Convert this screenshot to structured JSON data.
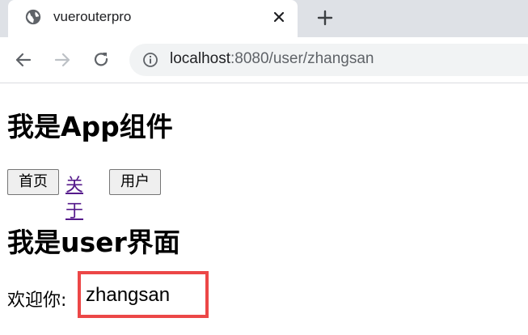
{
  "browser": {
    "tab": {
      "title": "vuerouterpro",
      "icon": "globe-icon",
      "close_icon": "close-icon"
    },
    "new_tab_icon": "plus-icon",
    "nav": {
      "back_icon": "arrow-left-icon",
      "forward_icon": "arrow-right-icon",
      "reload_icon": "reload-icon"
    },
    "address_bar": {
      "info_icon": "info-icon",
      "host": "localhost",
      "rest": ":8080/user/zhangsan"
    }
  },
  "page": {
    "app_heading": "我是App组件",
    "nav_links": {
      "home": "首页",
      "about": "关于",
      "user": "用户"
    },
    "user_heading": "我是user界面",
    "welcome_label": "欢迎你:",
    "username": "zhangsan",
    "highlight_color": "#ec4747"
  }
}
